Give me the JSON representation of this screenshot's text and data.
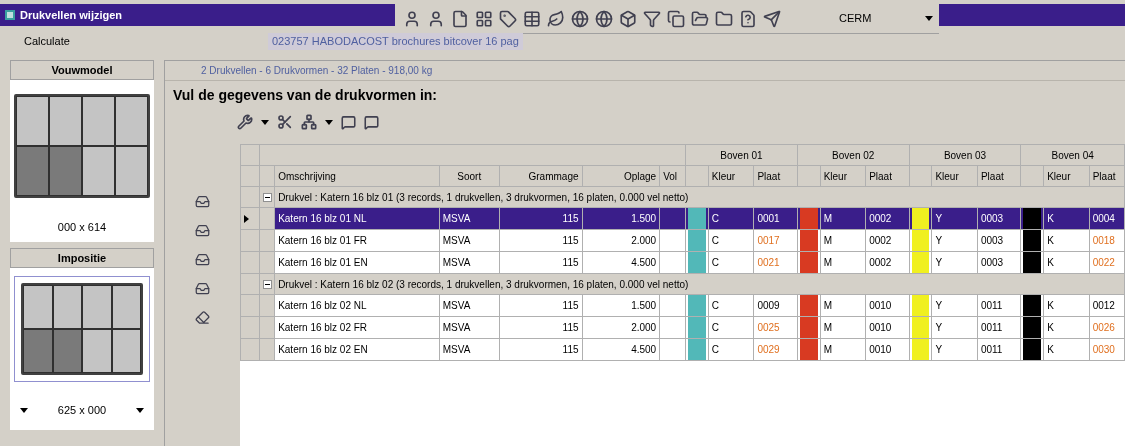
{
  "window": {
    "title": "Drukvellen wijzigen"
  },
  "menu": {
    "label": "Calculate"
  },
  "order_field": {
    "value": "023757 HABODACOST brochures bitcover 16 pag"
  },
  "company_combo": {
    "value": "CERM"
  },
  "fold_model": {
    "title": "Vouwmodel",
    "size": "000 x 614",
    "cells": [
      {
        "dark": false
      },
      {
        "dark": false
      },
      {
        "dark": false
      },
      {
        "dark": false
      },
      {
        "dark": true
      },
      {
        "dark": true
      },
      {
        "dark": false
      },
      {
        "dark": false
      }
    ]
  },
  "imposition": {
    "title": "Impositie",
    "size": "625 x 000",
    "cells": [
      {
        "dark": false
      },
      {
        "dark": false
      },
      {
        "dark": false
      },
      {
        "dark": false
      },
      {
        "dark": true
      },
      {
        "dark": true
      },
      {
        "dark": false
      },
      {
        "dark": false
      }
    ]
  },
  "summary": "2 Drukvellen - 6 Drukvormen - 32 Platen - 918,00 kg",
  "heading": "Vul de gegevens van de drukvormen in:",
  "grid": {
    "columns": [
      "Omschrijving",
      "Soort",
      "Grammage",
      "Oplage",
      "Vol"
    ],
    "bands": [
      {
        "label": "Boven 01",
        "columns": [
          "Kleur",
          "Plaat"
        ]
      },
      {
        "label": "Boven 02",
        "columns": [
          "Kleur",
          "Plaat"
        ]
      },
      {
        "label": "Boven 03",
        "columns": [
          "Kleur",
          "Plaat"
        ]
      },
      {
        "label": "Boven 04",
        "columns": [
          "Kleur",
          "Plaat"
        ]
      }
    ],
    "groups": [
      {
        "label": "Drukvel : Katern 16 blz 01 (3 records, 1 drukvellen, 3 drukvormen, 16 platen, 0.000 vel netto)",
        "expanded": true,
        "rows": [
          {
            "description": "Katern 16 blz 01 NL",
            "type": "MSVA",
            "grammage": "115",
            "oplage": "1.500",
            "selected": true,
            "plates": [
              {
                "color": "#52b8b8",
                "kleur": "C",
                "plaat": "0001",
                "modified": false
              },
              {
                "color": "#d83a22",
                "kleur": "M",
                "plaat": "0002",
                "modified": false
              },
              {
                "color": "#f0f020",
                "kleur": "Y",
                "plaat": "0003",
                "modified": false
              },
              {
                "color": "#000000",
                "kleur": "K",
                "plaat": "0004",
                "modified": false
              }
            ]
          },
          {
            "description": "Katern 16 blz 01 FR",
            "type": "MSVA",
            "grammage": "115",
            "oplage": "2.000",
            "selected": false,
            "plates": [
              {
                "color": "#52b8b8",
                "kleur": "C",
                "plaat": "0017",
                "modified": true
              },
              {
                "color": "#d83a22",
                "kleur": "M",
                "plaat": "0002",
                "modified": false
              },
              {
                "color": "#f0f020",
                "kleur": "Y",
                "plaat": "0003",
                "modified": false
              },
              {
                "color": "#000000",
                "kleur": "K",
                "plaat": "0018",
                "modified": true
              }
            ]
          },
          {
            "description": "Katern 16 blz 01 EN",
            "type": "MSVA",
            "grammage": "115",
            "oplage": "4.500",
            "selected": false,
            "plates": [
              {
                "color": "#52b8b8",
                "kleur": "C",
                "plaat": "0021",
                "modified": true
              },
              {
                "color": "#d83a22",
                "kleur": "M",
                "plaat": "0002",
                "modified": false
              },
              {
                "color": "#f0f020",
                "kleur": "Y",
                "plaat": "0003",
                "modified": false
              },
              {
                "color": "#000000",
                "kleur": "K",
                "plaat": "0022",
                "modified": true
              }
            ]
          }
        ]
      },
      {
        "label": "Drukvel : Katern 16 blz 02 (3 records, 1 drukvellen, 3 drukvormen, 16 platen, 0.000 vel netto)",
        "expanded": true,
        "rows": [
          {
            "description": "Katern 16 blz 02 NL",
            "type": "MSVA",
            "grammage": "115",
            "oplage": "1.500",
            "selected": false,
            "plates": [
              {
                "color": "#52b8b8",
                "kleur": "C",
                "plaat": "0009",
                "modified": false
              },
              {
                "color": "#d83a22",
                "kleur": "M",
                "plaat": "0010",
                "modified": false
              },
              {
                "color": "#f0f020",
                "kleur": "Y",
                "plaat": "0011",
                "modified": false
              },
              {
                "color": "#000000",
                "kleur": "K",
                "plaat": "0012",
                "modified": false
              }
            ]
          },
          {
            "description": "Katern 16 blz 02 FR",
            "type": "MSVA",
            "grammage": "115",
            "oplage": "2.000",
            "selected": false,
            "plates": [
              {
                "color": "#52b8b8",
                "kleur": "C",
                "plaat": "0025",
                "modified": true
              },
              {
                "color": "#d83a22",
                "kleur": "M",
                "plaat": "0010",
                "modified": false
              },
              {
                "color": "#f0f020",
                "kleur": "Y",
                "plaat": "0011",
                "modified": false
              },
              {
                "color": "#000000",
                "kleur": "K",
                "plaat": "0026",
                "modified": true
              }
            ]
          },
          {
            "description": "Katern 16 blz 02 EN",
            "type": "MSVA",
            "grammage": "115",
            "oplage": "4.500",
            "selected": false,
            "plates": [
              {
                "color": "#52b8b8",
                "kleur": "C",
                "plaat": "0029",
                "modified": true
              },
              {
                "color": "#d83a22",
                "kleur": "M",
                "plaat": "0010",
                "modified": false
              },
              {
                "color": "#f0f020",
                "kleur": "Y",
                "plaat": "0011",
                "modified": false
              },
              {
                "color": "#000000",
                "kleur": "K",
                "plaat": "0030",
                "modified": true
              }
            ]
          }
        ]
      }
    ]
  }
}
